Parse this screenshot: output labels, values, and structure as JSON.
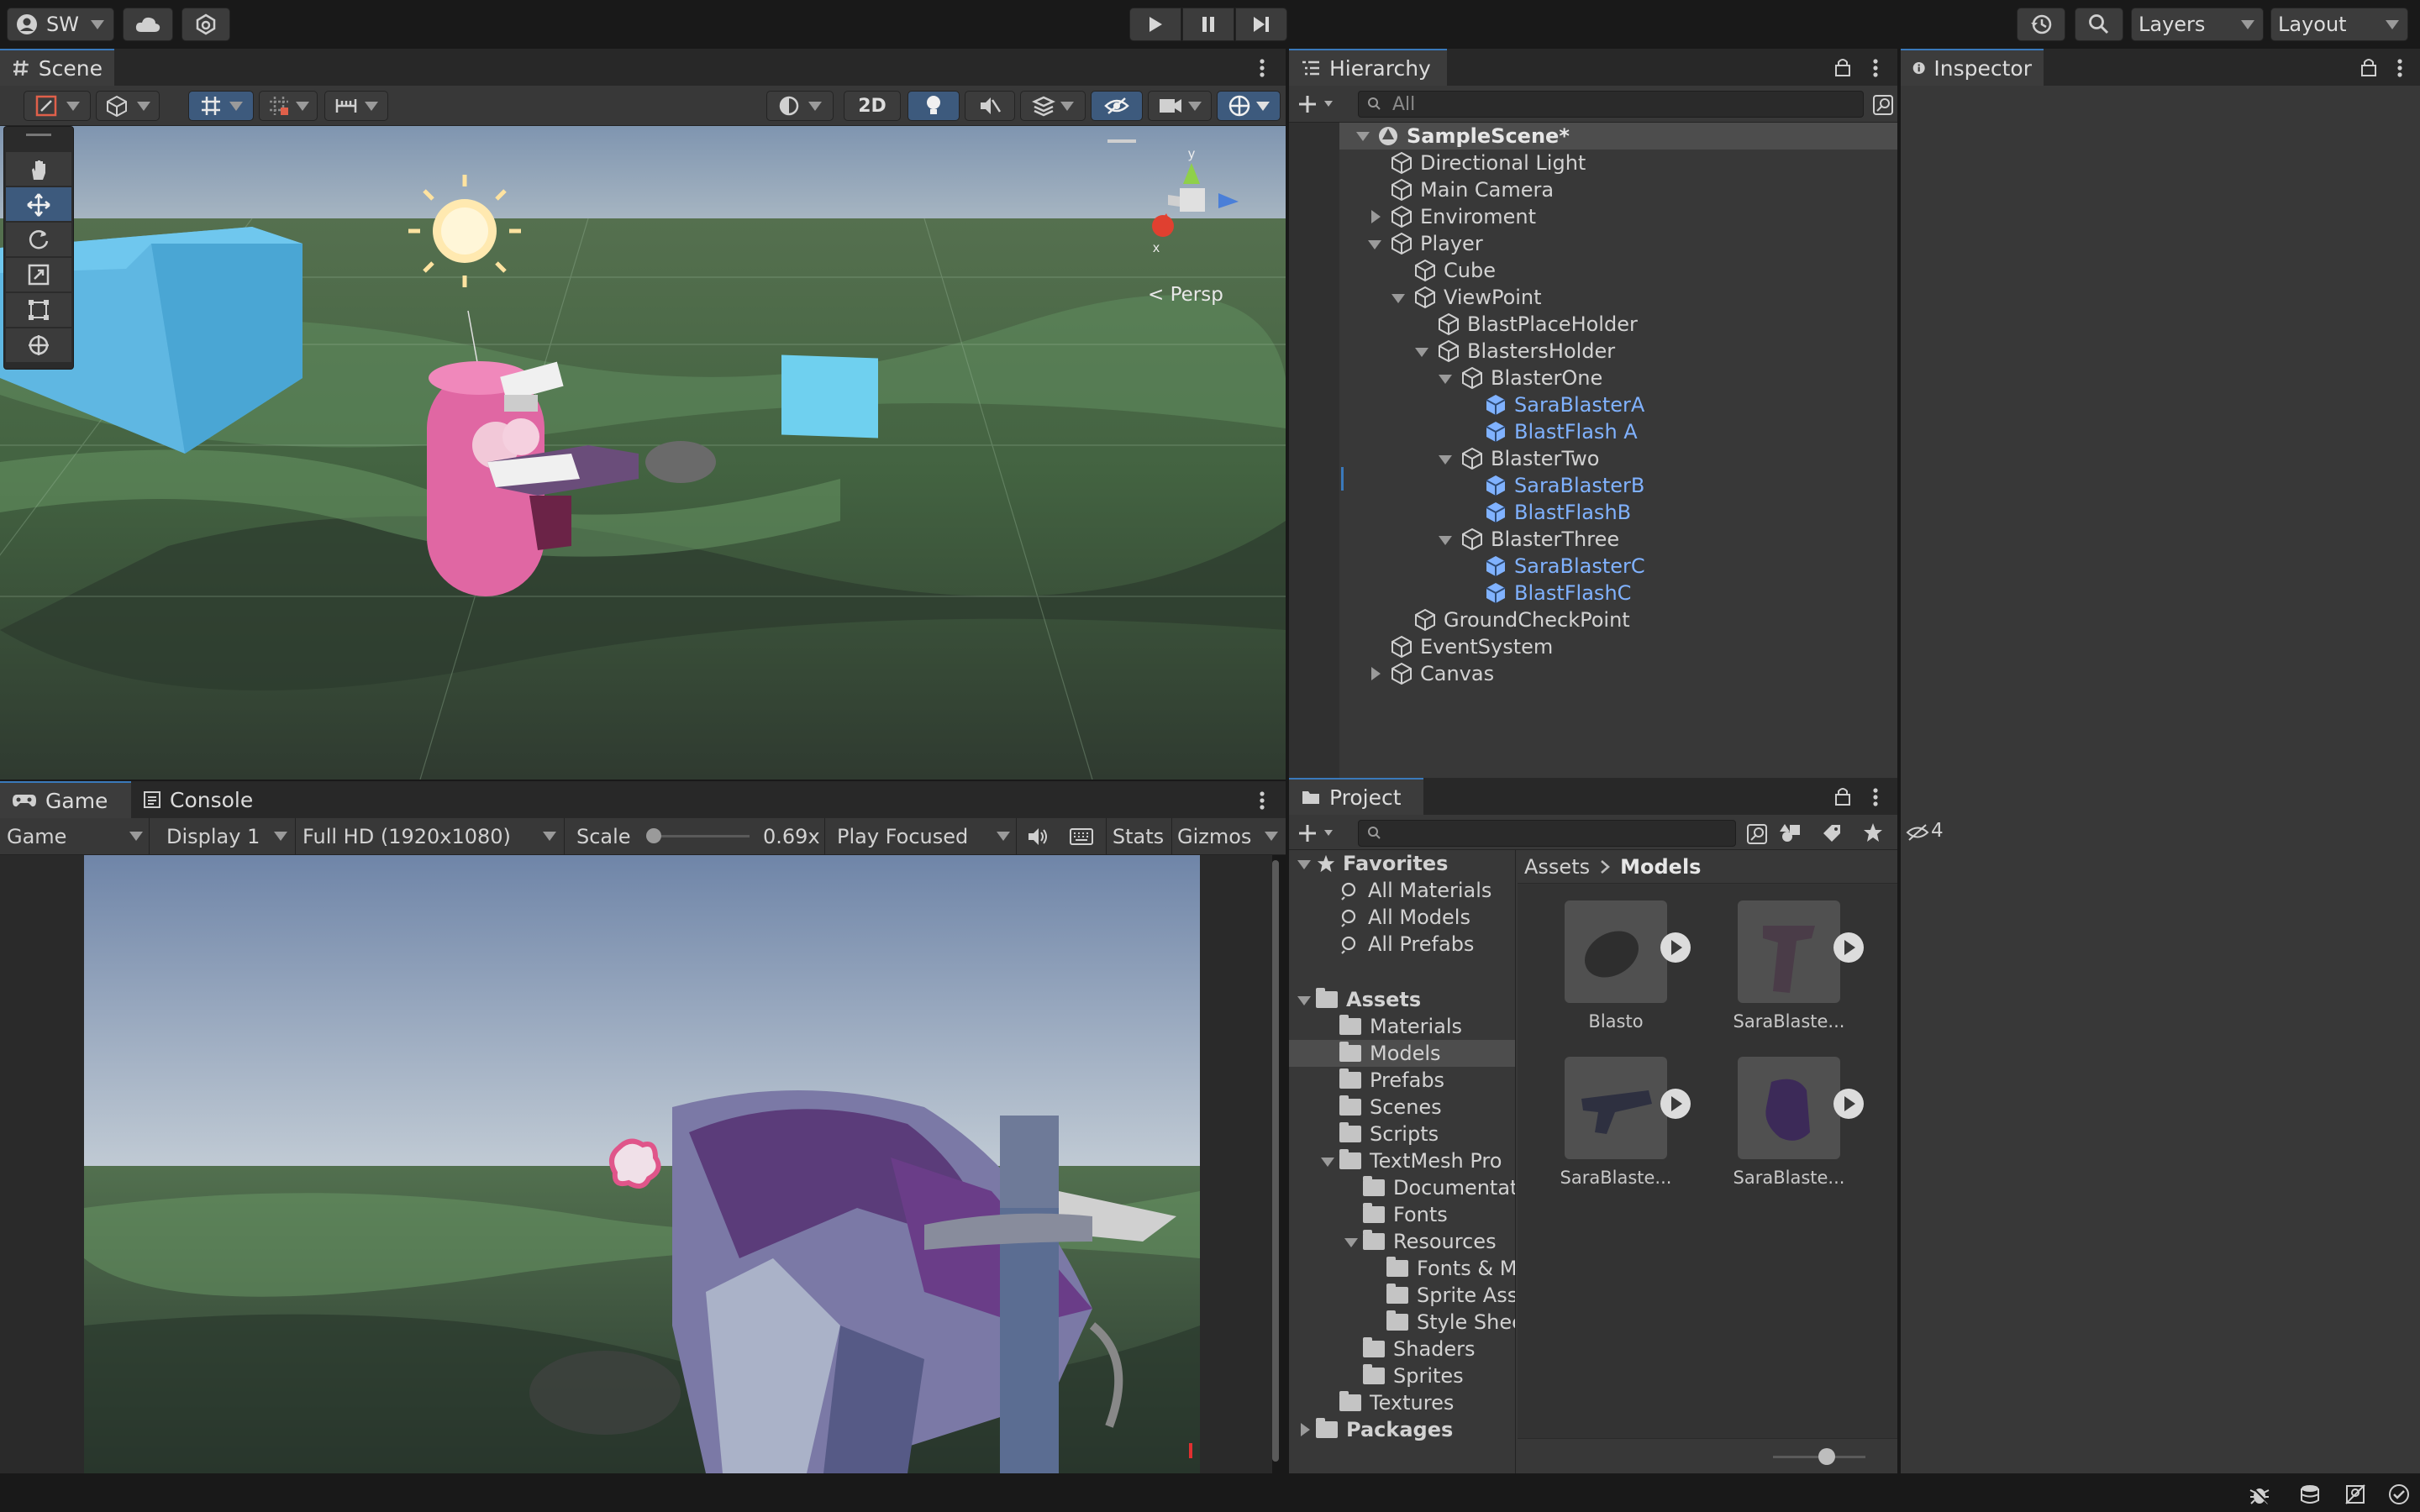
{
  "account": {
    "label": "SW"
  },
  "topbar": {
    "layers": "Layers",
    "layout": "Layout"
  },
  "scene": {
    "tab": "Scene",
    "btn_2d": "2D",
    "persp": "< Persp",
    "axis_y": "y",
    "axis_x": "x"
  },
  "hierarchy": {
    "tab": "Hierarchy",
    "search_placeholder": "All",
    "scene_name": "SampleScene*",
    "items": [
      {
        "label": "Directional Light"
      },
      {
        "label": "Main Camera"
      },
      {
        "label": "Enviroment"
      },
      {
        "label": "Player"
      },
      {
        "label": "Cube"
      },
      {
        "label": "ViewPoint"
      },
      {
        "label": "BlastPlaceHolder"
      },
      {
        "label": "BlastersHolder"
      },
      {
        "label": "BlasterOne"
      },
      {
        "label": "SaraBlasterA"
      },
      {
        "label": "BlastFlash A"
      },
      {
        "label": "BlasterTwo"
      },
      {
        "label": "SaraBlasterB"
      },
      {
        "label": "BlastFlashB"
      },
      {
        "label": "BlasterThree"
      },
      {
        "label": "SaraBlasterC"
      },
      {
        "label": "BlastFlashC"
      },
      {
        "label": "GroundCheckPoint"
      },
      {
        "label": "EventSystem"
      },
      {
        "label": "Canvas"
      }
    ]
  },
  "inspector": {
    "tab": "Inspector"
  },
  "game": {
    "tab_game": "Game",
    "tab_console": "Console",
    "view": "Game",
    "display": "Display 1",
    "resolution": "Full HD (1920x1080)",
    "scale_label": "Scale",
    "scale_value": "0.69x",
    "play_mode": "Play Focused",
    "stats": "Stats",
    "gizmos": "Gizmos",
    "scale_fraction": 0.05
  },
  "project": {
    "tab": "Project",
    "hidden_count": "4",
    "favorites": {
      "title": "Favorites",
      "items": [
        "All Materials",
        "All Models",
        "All Prefabs"
      ]
    },
    "assets": {
      "title": "Assets",
      "folders": [
        "Materials",
        "Models",
        "Prefabs",
        "Scenes",
        "Scripts",
        "TextMesh Pro"
      ],
      "textmesh": [
        "Documentati",
        "Fonts",
        "Resources"
      ],
      "resources": [
        "Fonts & Ma",
        "Sprite Asse",
        "Style Shee"
      ],
      "more": [
        "Shaders",
        "Sprites"
      ],
      "textures": "Textures"
    },
    "packages": "Packages",
    "breadcrumb": {
      "root": "Assets",
      "current": "Models"
    },
    "grid": [
      {
        "name": "Blasto"
      },
      {
        "name": "SaraBlaste..."
      },
      {
        "name": "SaraBlaste..."
      },
      {
        "name": "SaraBlaste..."
      }
    ]
  },
  "colors": {
    "accent": "#3a79bb",
    "blue_text": "#80b2ff",
    "selection": "#4d4d4d"
  }
}
